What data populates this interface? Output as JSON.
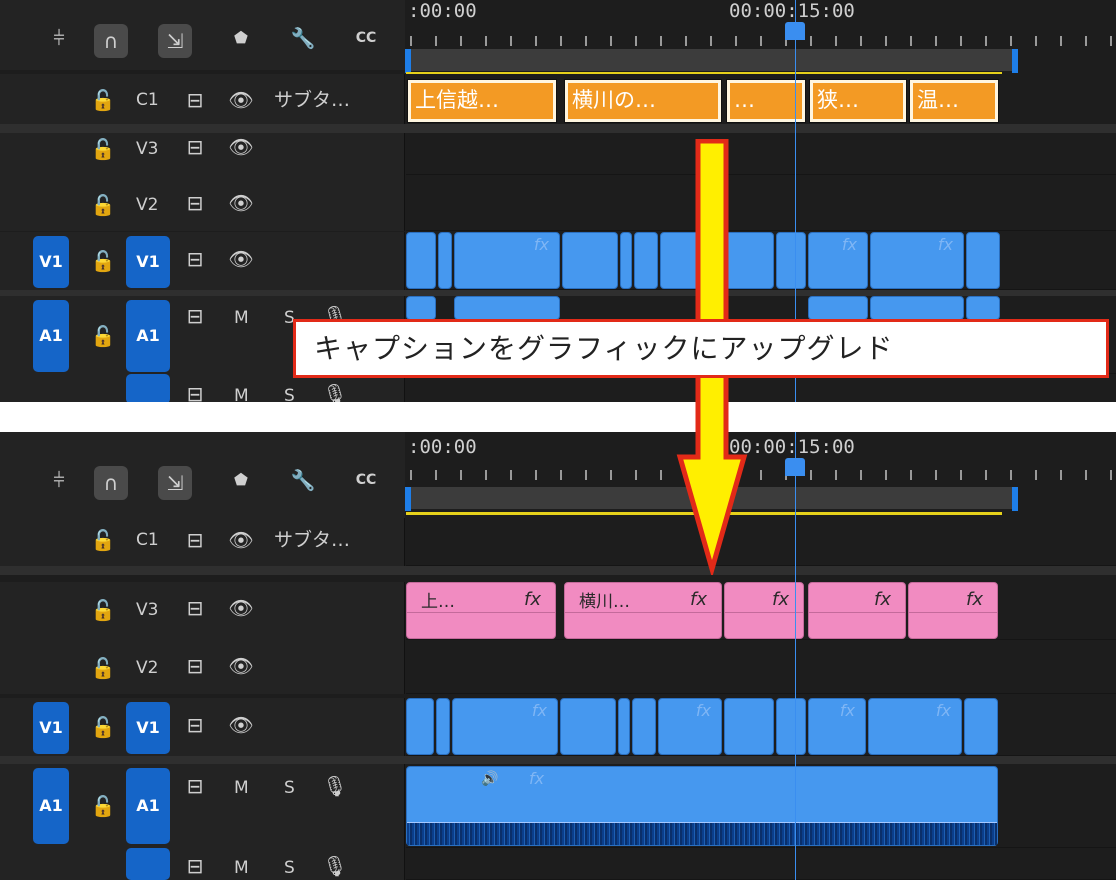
{
  "timeline": {
    "timecode_start": ":00:00",
    "timecode_mid": "00:00:15:00",
    "toolbar_icons": [
      "nest-sequence-icon",
      "snap-magnet-icon",
      "linked-selection-icon",
      "add-marker-icon",
      "wrench-icon",
      "captions-icon"
    ]
  },
  "before": {
    "tracks": {
      "c1": {
        "name": "C1",
        "title": "サブタ…"
      },
      "v3": {
        "name": "V3"
      },
      "v2": {
        "name": "V2"
      },
      "v1": {
        "source": "V1",
        "name": "V1"
      },
      "a1": {
        "source": "A1",
        "name": "A1",
        "m": "M",
        "s": "S"
      },
      "a2": {
        "m": "M",
        "s": "S"
      }
    },
    "caption_clips": [
      "上信越…",
      "横川の…",
      "…",
      "狭…",
      "温…"
    ]
  },
  "after": {
    "tracks": {
      "c1": {
        "name": "C1",
        "title": "サブタ…"
      },
      "v3": {
        "name": "V3"
      },
      "v2": {
        "name": "V2"
      },
      "v1": {
        "source": "V1",
        "name": "V1"
      },
      "a1": {
        "source": "A1",
        "name": "A1",
        "m": "M",
        "s": "S"
      },
      "a2": {
        "m": "M",
        "s": "S"
      }
    },
    "graphic_clips": [
      "上…",
      "横川…",
      "",
      "",
      ""
    ]
  },
  "fx_label": "fx",
  "annotation": "キャプションをグラフィックにアップグレド",
  "colors": {
    "caption_clip": "#f39a24",
    "graphic_clip": "#f18bc1",
    "video_clip": "#4698ef",
    "arrow_fill": "#ffef00",
    "arrow_stroke": "#e22a18",
    "track_badge": "#1565c8"
  }
}
